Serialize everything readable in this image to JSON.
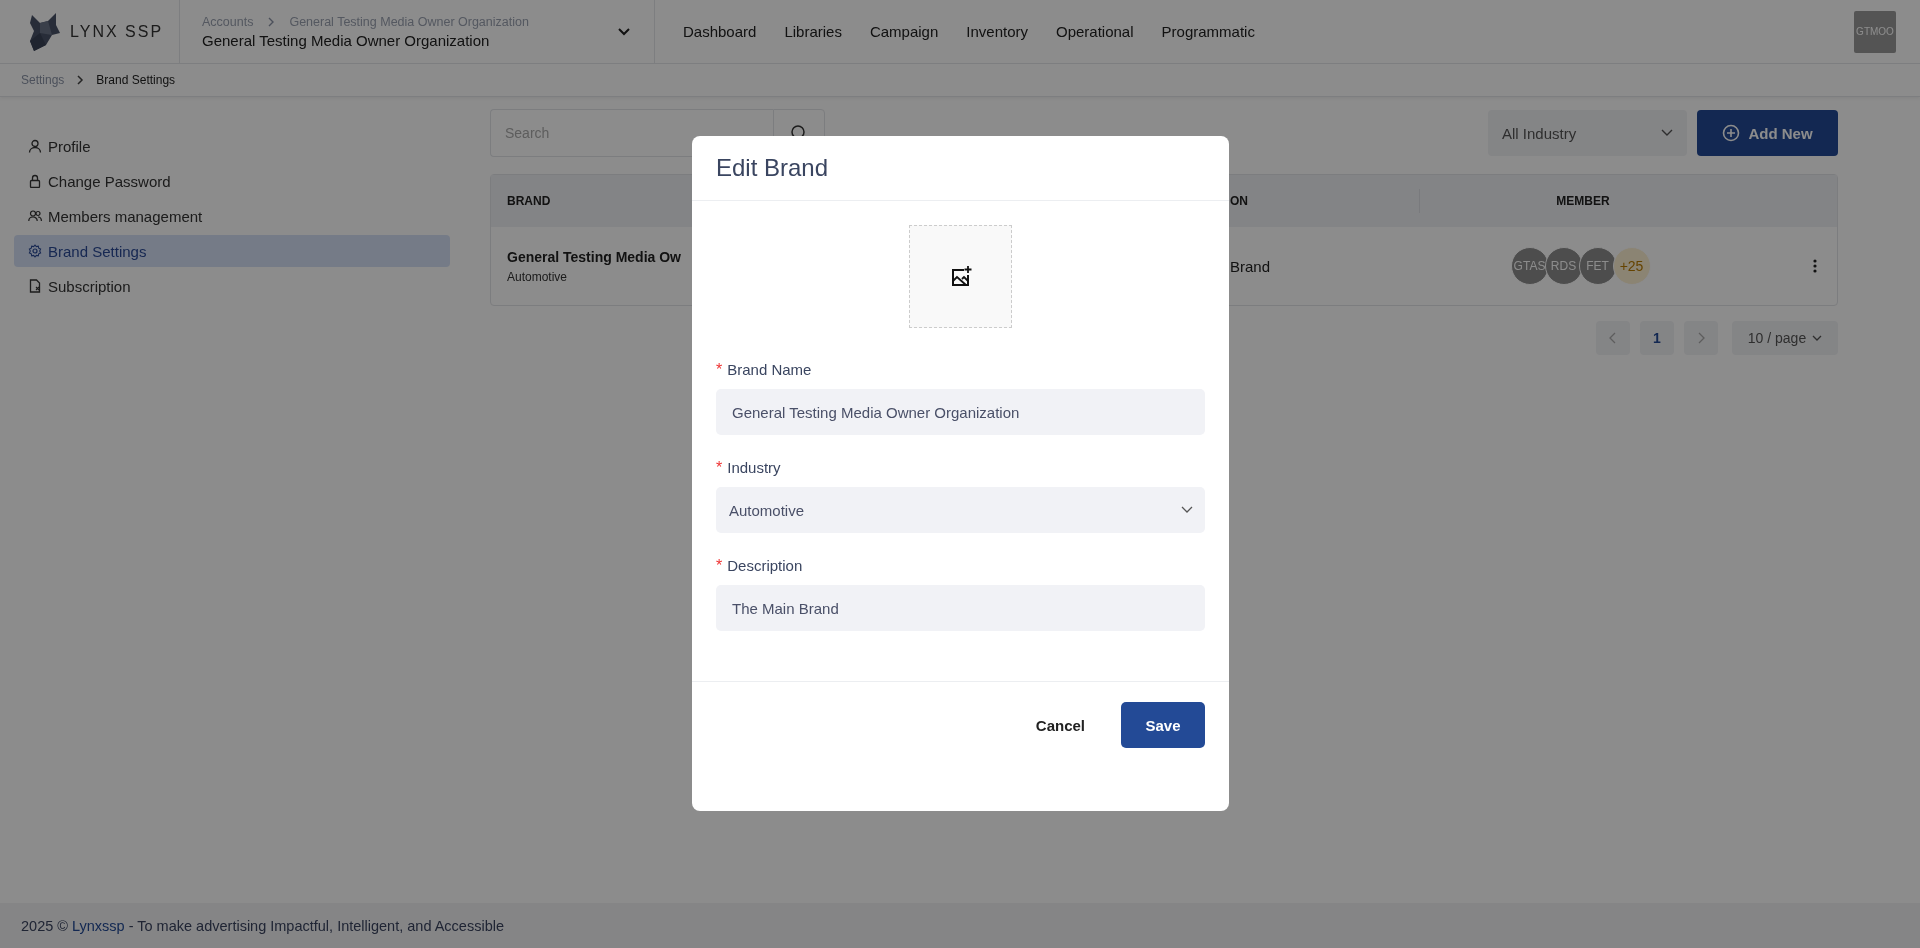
{
  "header": {
    "brand": "LYNX SSP",
    "account": {
      "crumbs": [
        "Accounts",
        "General Testing Media Owner Organization"
      ],
      "name": "General Testing Media Owner Organization"
    },
    "nav": [
      {
        "label": "Dashboard",
        "selected": false
      },
      {
        "label": "Libraries",
        "selected": false
      },
      {
        "label": "Campaign",
        "selected": false
      },
      {
        "label": "Inventory",
        "selected": false
      },
      {
        "label": "Operational",
        "selected": false
      },
      {
        "label": "Programmatic",
        "selected": false
      }
    ],
    "avatar": "GTMOO"
  },
  "breadcrumb": [
    "Settings",
    "Brand Settings"
  ],
  "sidebar": {
    "items": [
      {
        "label": "Profile",
        "selected": false
      },
      {
        "label": "Change Password",
        "selected": false
      },
      {
        "label": "Members management",
        "selected": false
      },
      {
        "label": "Brand Settings",
        "selected": true
      },
      {
        "label": "Subscription",
        "selected": false
      }
    ]
  },
  "toolbar": {
    "search": {
      "placeholder": "Search"
    },
    "filter": "All Industry",
    "add_button": "Add New"
  },
  "table": {
    "columns": [
      "BRAND",
      "ON",
      "MEMBER"
    ],
    "rows": [
      {
        "brand": "General Testing Media Ow",
        "industry": "Automotive",
        "description": "Brand",
        "members": [
          {
            "initials": "GTAS",
            "kind": "person"
          },
          {
            "initials": "RDS",
            "kind": "person"
          },
          {
            "initials": "FET",
            "kind": "person"
          },
          {
            "initials": "+25",
            "kind": "more"
          }
        ]
      }
    ]
  },
  "pagination": {
    "pages": [
      {
        "label": "1",
        "selected": true
      }
    ],
    "page_size": "10 / page"
  },
  "modal": {
    "title": "Edit Brand",
    "required_mark": "*",
    "fields": [
      {
        "label": "Brand Name",
        "required": true,
        "kind": "text",
        "value": "General Testing Media Owner Organization"
      },
      {
        "label": "Industry",
        "required": true,
        "kind": "select",
        "value": "Automotive"
      },
      {
        "label": "Description",
        "required": true,
        "kind": "text",
        "value": "The Main Brand"
      }
    ],
    "cancel": "Cancel",
    "save": "Save"
  },
  "footer": {
    "prefix": "2025 ©",
    "link": "Lynxssp",
    "suffix": "- To make advertising Impactful, Intelligent, and Accessible"
  }
}
